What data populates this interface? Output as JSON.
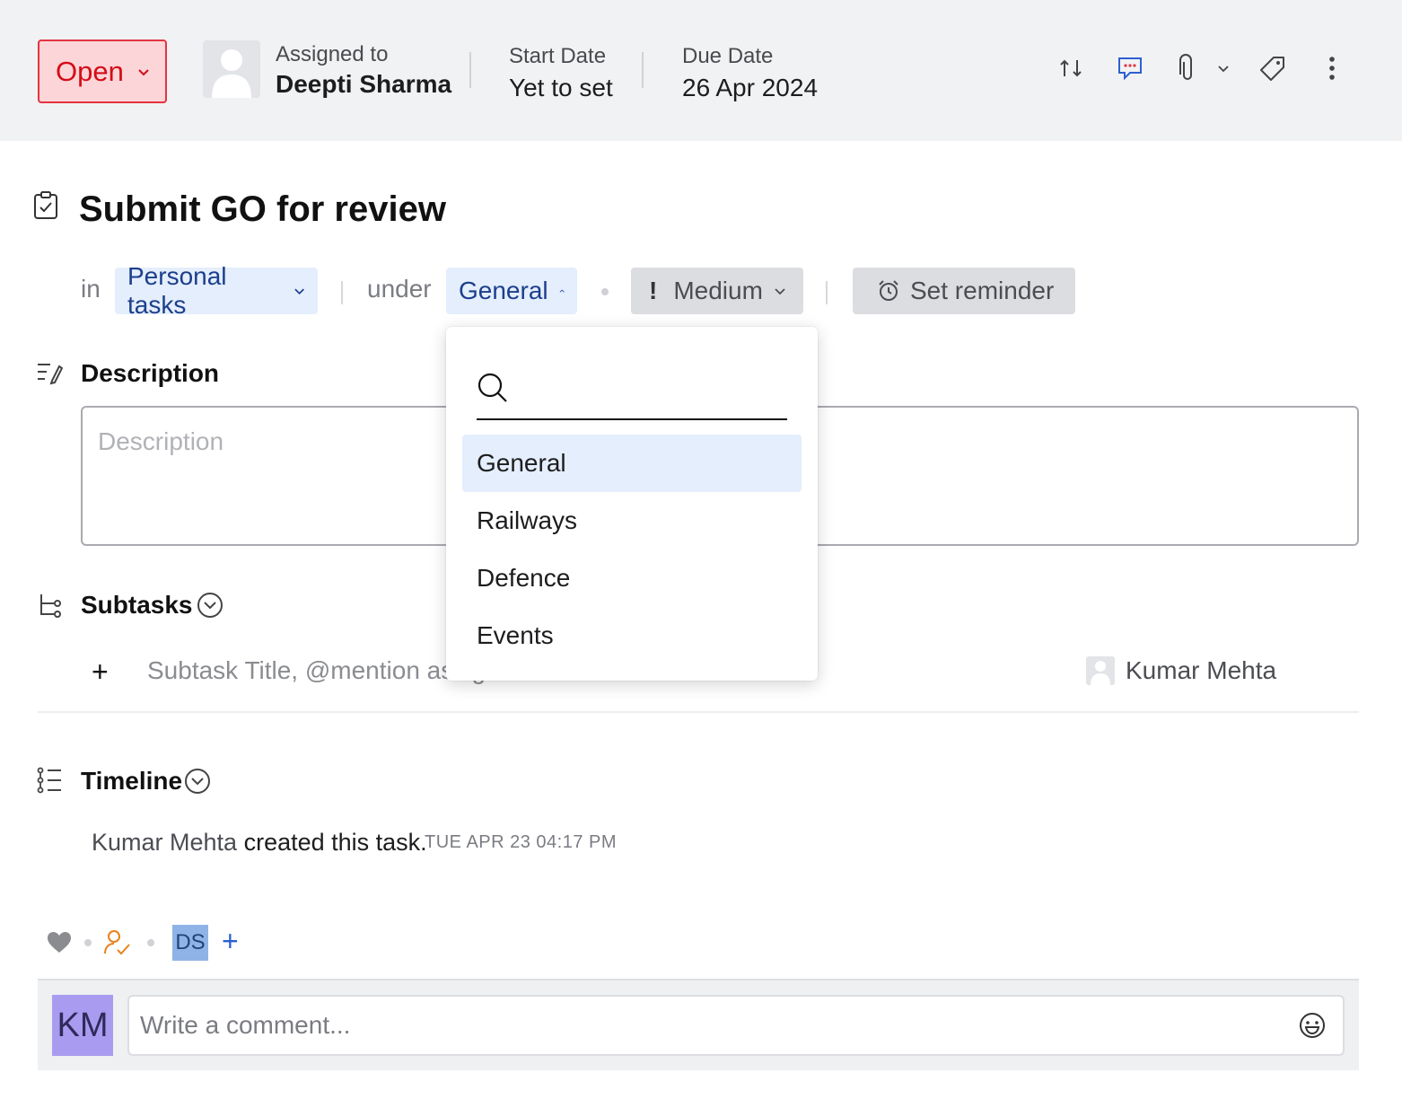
{
  "header": {
    "status": "Open",
    "assigned_label": "Assigned to",
    "assigned_value": "Deepti Sharma",
    "start_label": "Start Date",
    "start_value": "Yet to set",
    "due_label": "Due Date",
    "due_value": "26 Apr 2024",
    "icons": [
      "swap-icon",
      "comment-icon",
      "attachment-icon",
      "chevron-down-icon",
      "tag-icon",
      "more-icon"
    ]
  },
  "task": {
    "title": "Submit GO for review",
    "in_label": "in",
    "list": "Personal tasks",
    "under_label": "under",
    "section": "General",
    "priority": "Medium",
    "priority_mark": "!",
    "reminder": "Set reminder"
  },
  "description": {
    "heading": "Description",
    "placeholder": "Description"
  },
  "subtasks": {
    "heading": "Subtasks",
    "add_symbol": "+",
    "placeholder": "Subtask Title, @mention assignee",
    "assignee": "Kumar Mehta"
  },
  "timeline": {
    "heading": "Timeline",
    "actor": "Kumar Mehta",
    "action": " created this task.",
    "timestamp": "TUE APR 23 04:17 PM"
  },
  "footer": {
    "follower_initials": "DS",
    "add_symbol": "+",
    "commenter_initials": "KM",
    "comment_placeholder": "Write a comment..."
  },
  "dropdown": {
    "items": [
      {
        "label": "General",
        "selected": true
      },
      {
        "label": "Railways",
        "selected": false
      },
      {
        "label": "Defence",
        "selected": false
      },
      {
        "label": "Events",
        "selected": false
      }
    ]
  },
  "colors": {
    "status_bg": "#fcd5d8",
    "status_text": "#d40c17",
    "chip_blue_bg": "#e4eefc",
    "chip_blue_text": "#1c3e8c",
    "accent_blue": "#2d5fd1",
    "avatar_km": "#a99cf0",
    "avatar_ds": "#8fb3e6"
  }
}
